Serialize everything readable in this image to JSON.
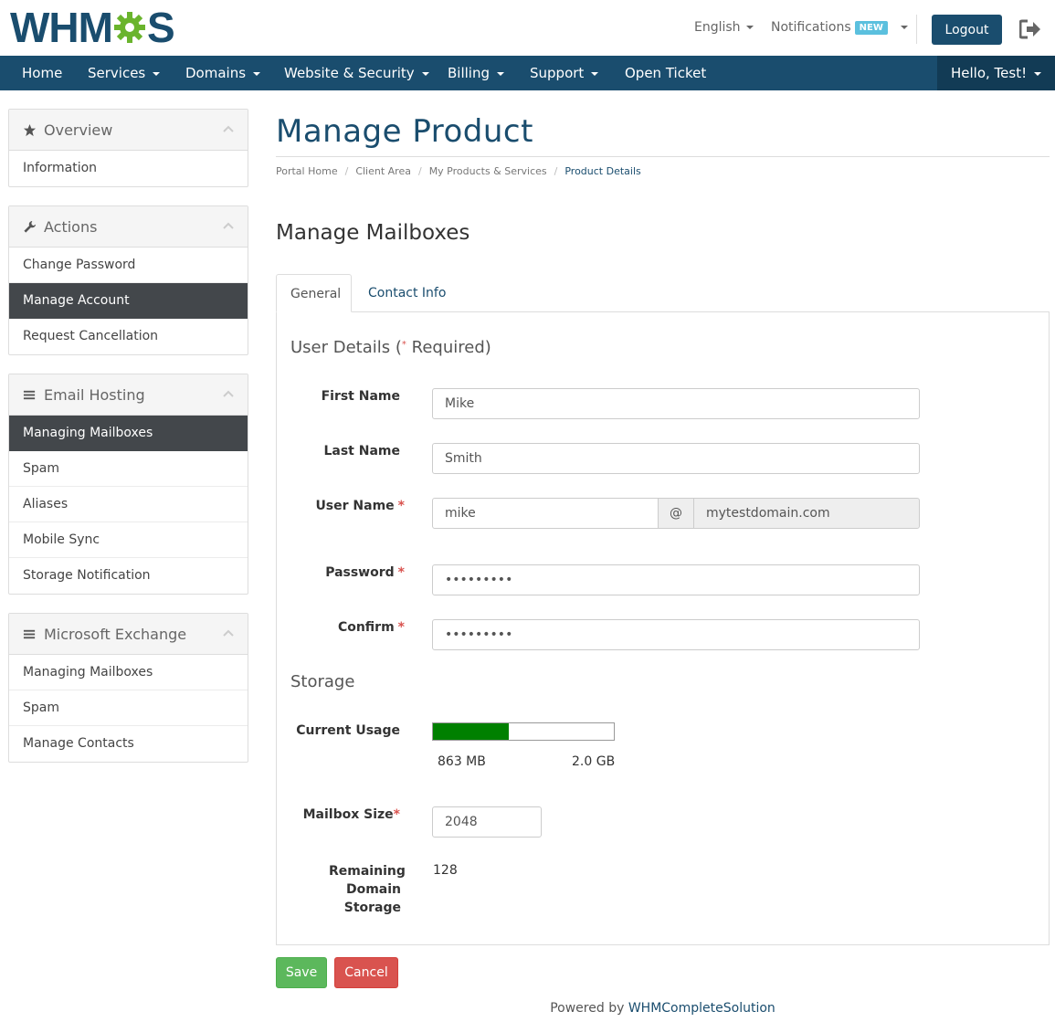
{
  "header": {
    "logo_text": "WHMCS",
    "language": "English",
    "notifications": "Notifications",
    "notifications_badge": "NEW",
    "logout": "Logout"
  },
  "nav": {
    "items": [
      "Home",
      "Services",
      "Domains",
      "Website & Security",
      "Billing",
      "Support",
      "Open Ticket"
    ],
    "user_greeting": "Hello, Test!"
  },
  "sidebar": {
    "overview": {
      "title": "Overview",
      "items": [
        "Information"
      ]
    },
    "actions": {
      "title": "Actions",
      "items": [
        "Change Password",
        "Manage Account",
        "Request Cancellation"
      ],
      "active": "Manage Account"
    },
    "email_hosting": {
      "title": "Email Hosting",
      "items": [
        "Managing Mailboxes",
        "Spam",
        "Aliases",
        "Mobile Sync",
        "Storage Notification"
      ],
      "active": "Managing Mailboxes"
    },
    "exchange": {
      "title": "Microsoft Exchange",
      "items": [
        "Managing Mailboxes",
        "Spam",
        "Manage Contacts"
      ]
    }
  },
  "main": {
    "title": "Manage Product",
    "breadcrumb": [
      "Portal Home",
      "Client Area",
      "My Products & Services",
      "Product Details"
    ],
    "section_title": "Manage Mailboxes",
    "tabs": [
      "General",
      "Contact Info"
    ]
  },
  "form": {
    "user_details_title": "User Details (",
    "user_details_required": "Required)",
    "first_name_label": "First Name",
    "first_name": "Mike",
    "last_name_label": "Last Name",
    "last_name": "Smith",
    "user_name_label": "User Name",
    "user_name": "mike",
    "at_sign": "@",
    "domain": "mytestdomain.com",
    "password_label": "Password",
    "password": "password1",
    "confirm_label": "Confirm",
    "confirm": "password1",
    "storage_title": "Storage",
    "current_usage_label": "Current Usage",
    "usage_used": "863 MB",
    "usage_total": "2.0 GB",
    "usage_fraction": 0.42,
    "mailbox_size_label": "Mailbox Size",
    "mailbox_size": "2048",
    "remaining_label": "Remaining Domain Storage",
    "remaining_value": "128",
    "save": "Save",
    "cancel": "Cancel"
  },
  "footer": {
    "powered_by": "Powered by",
    "brand": "WHMCompleteSolution"
  },
  "colors": {
    "brand": "#1a4d6e",
    "active_item": "#43474b",
    "usage_fill": "#008000",
    "save": "#5cb85c",
    "cancel": "#d9534f",
    "badge": "#5bc0de"
  }
}
